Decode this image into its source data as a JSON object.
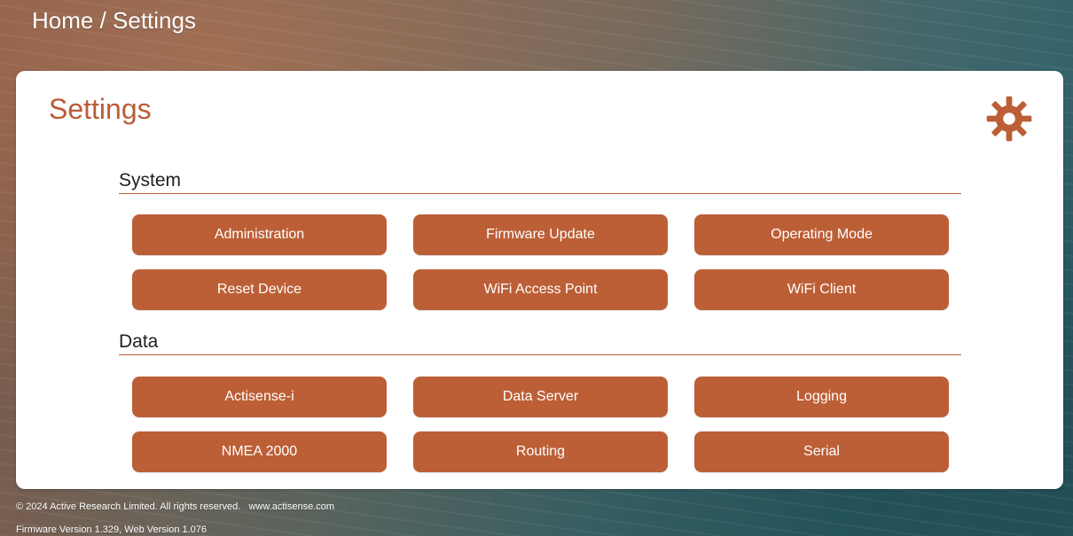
{
  "page": {
    "breadcrumb": "Home / Settings"
  },
  "card": {
    "title": "Settings",
    "header_icon": "gear-icon",
    "accent_color": "#bc5f36"
  },
  "sections": [
    {
      "title": "System",
      "buttons": [
        {
          "label": "Administration"
        },
        {
          "label": "Firmware Update"
        },
        {
          "label": "Operating Mode"
        },
        {
          "label": "Reset Device"
        },
        {
          "label": "WiFi Access Point"
        },
        {
          "label": "WiFi Client"
        }
      ]
    },
    {
      "title": "Data",
      "buttons": [
        {
          "label": "Actisense-i"
        },
        {
          "label": "Data Server"
        },
        {
          "label": "Logging"
        },
        {
          "label": "NMEA 2000"
        },
        {
          "label": "Routing"
        },
        {
          "label": "Serial"
        }
      ]
    }
  ],
  "footer": {
    "copyright": "© 2024 Active Research Limited. All rights reserved.",
    "site_link": "www.actisense.com",
    "version_text": "Firmware Version 1.329, Web Version 1.076"
  }
}
